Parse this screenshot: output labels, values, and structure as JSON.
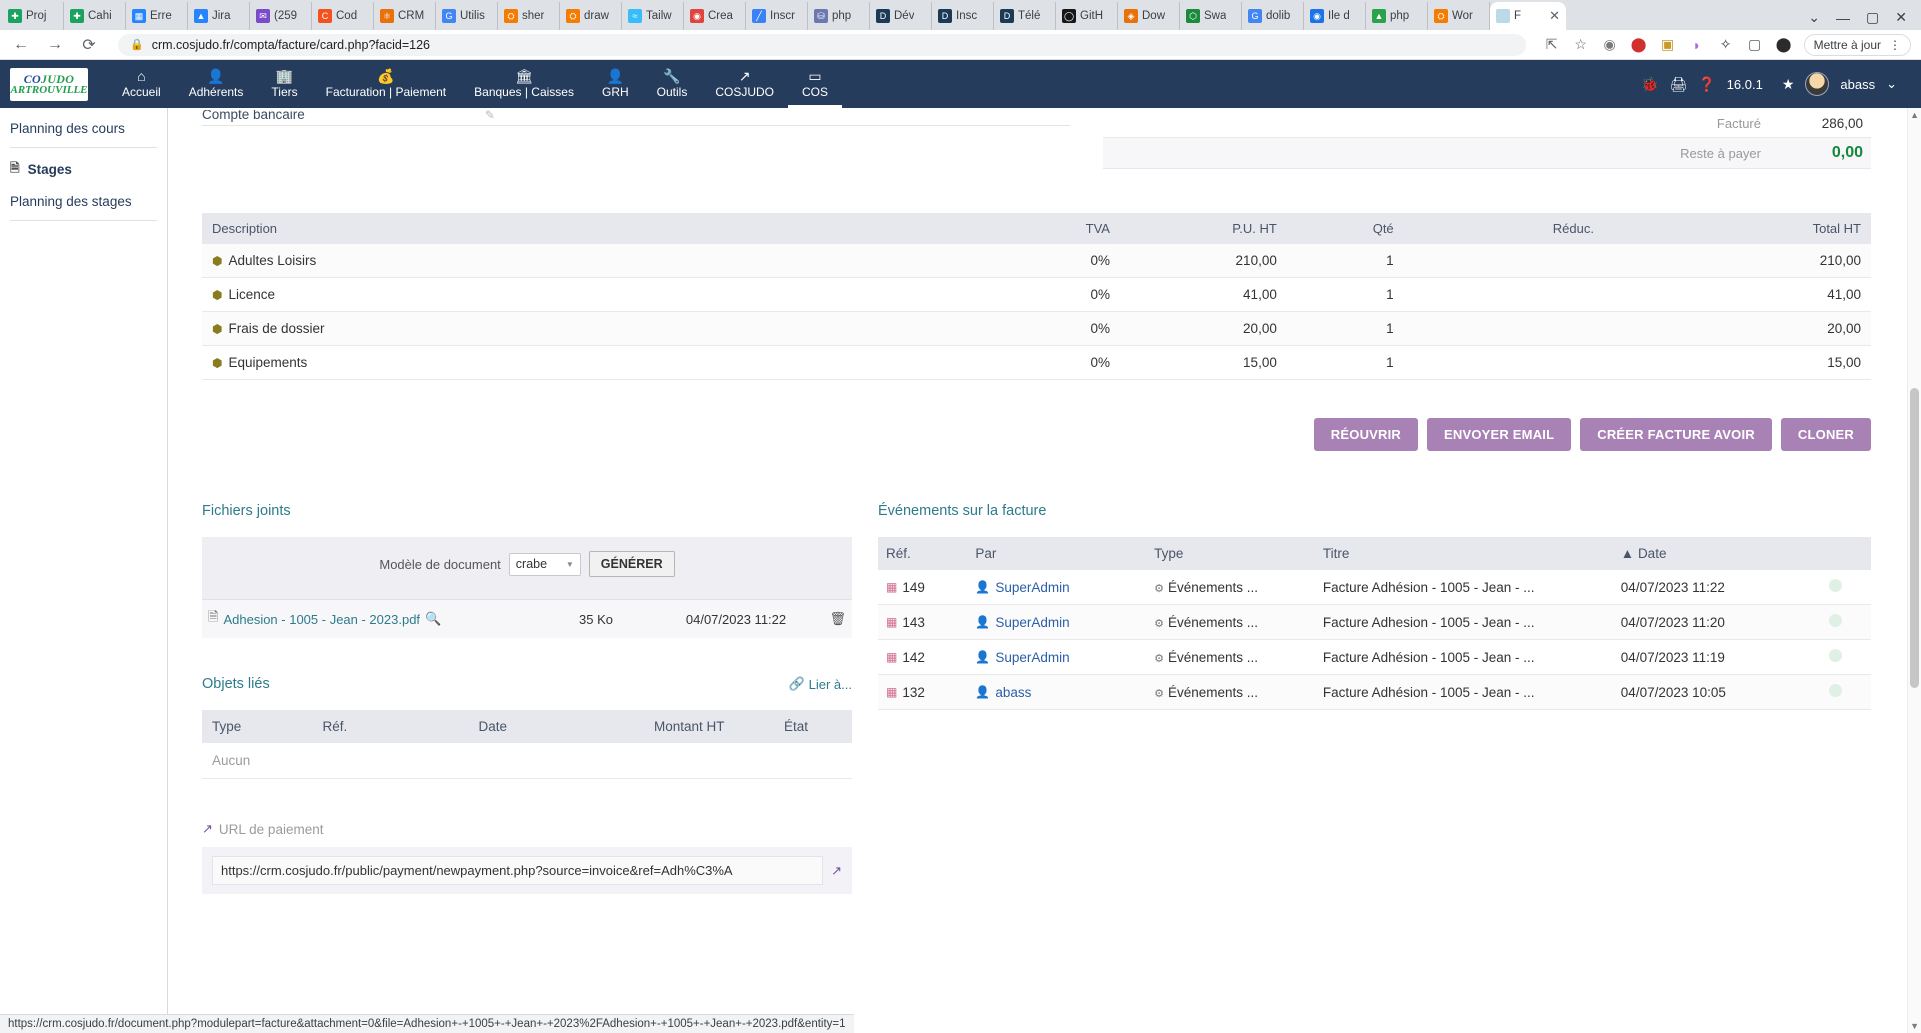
{
  "browser": {
    "tabs": [
      {
        "label": "Proj",
        "color": "#1aa260",
        "glyph": "✚"
      },
      {
        "label": "Cahi",
        "color": "#1aa260",
        "glyph": "✚"
      },
      {
        "label": "Erre",
        "color": "#2684ff",
        "glyph": "▦"
      },
      {
        "label": "Jira",
        "color": "#2684ff",
        "glyph": "▲"
      },
      {
        "label": "(259",
        "color": "#7b4cc9",
        "glyph": "✉"
      },
      {
        "label": "Cod",
        "color": "#f4511e",
        "glyph": "C"
      },
      {
        "label": "CRM",
        "color": "#e8710a",
        "glyph": "⚛"
      },
      {
        "label": "Utilis",
        "color": "#4285f4",
        "glyph": "G"
      },
      {
        "label": "sher",
        "color": "#f57c00",
        "glyph": "⛭"
      },
      {
        "label": "draw",
        "color": "#f57c00",
        "glyph": "⛭"
      },
      {
        "label": "Tailw",
        "color": "#38bdf8",
        "glyph": "≈"
      },
      {
        "label": "Crea",
        "color": "#e0443e",
        "glyph": "◉"
      },
      {
        "label": "Inscr",
        "color": "#3b82f6",
        "glyph": "╱"
      },
      {
        "label": "php",
        "color": "#6c78af",
        "glyph": "⛁"
      },
      {
        "label": "Dév",
        "color": "#1b3a57",
        "glyph": "D"
      },
      {
        "label": "Insc",
        "color": "#1b3a57",
        "glyph": "D"
      },
      {
        "label": "Télé",
        "color": "#1b3a57",
        "glyph": "D"
      },
      {
        "label": "GitH",
        "color": "#181717",
        "glyph": "◯"
      },
      {
        "label": "Dow",
        "color": "#e8710a",
        "glyph": "◈"
      },
      {
        "label": "Swa",
        "color": "#1b8a3a",
        "glyph": "⬡"
      },
      {
        "label": "dolib",
        "color": "#4285f4",
        "glyph": "G"
      },
      {
        "label": "Ile d",
        "color": "#1a73e8",
        "glyph": "◉"
      },
      {
        "label": "php",
        "color": "#2ba24c",
        "glyph": "▲"
      },
      {
        "label": "Wor",
        "color": "#f57c00",
        "glyph": "⛭"
      }
    ],
    "active_tab": {
      "label": "F",
      "close": "✕",
      "glyph": "▨"
    },
    "tabstrip_controls": {
      "chevron": "⌄",
      "minimize": "—",
      "maximize": "▢",
      "close": "✕"
    },
    "nav": {
      "back": "←",
      "forward": "→",
      "reload": "⟳"
    },
    "omnibox": {
      "lock": "🔒",
      "url": "crm.cosjudo.fr/compta/facture/card.php?facid=126"
    },
    "toolbar_icons": [
      "share-icon",
      "star-icon",
      "pocket-icon",
      "adblock-icon",
      "extension-badge-icon",
      "purple-ext-icon",
      "puzzle-icon",
      "sidebar-icon",
      "profile-icon"
    ],
    "update_button": "Mettre à jour",
    "menu_button": "⋮"
  },
  "app_header": {
    "logo_line1_a": "CO",
    "logo_line1_b": "JUDO",
    "logo_line2": "ARTROUVILLE",
    "menu": [
      {
        "label": "Accueil",
        "icon": "home-icon",
        "glyph": "⌂",
        "active": false
      },
      {
        "label": "Adhérents",
        "icon": "user-icon",
        "glyph": "👤",
        "active": false
      },
      {
        "label": "Tiers",
        "icon": "building-icon",
        "glyph": "🏢",
        "active": false
      },
      {
        "label": "Facturation | Paiement",
        "icon": "invoice-icon",
        "glyph": "💰",
        "active": false
      },
      {
        "label": "Banques | Caisses",
        "icon": "bank-icon",
        "glyph": "🏛",
        "active": false
      },
      {
        "label": "GRH",
        "icon": "hr-icon",
        "glyph": "👤",
        "active": false
      },
      {
        "label": "Outils",
        "icon": "wrench-icon",
        "glyph": "🔧",
        "active": false
      },
      {
        "label": "COSJUDO",
        "icon": "external-icon",
        "glyph": "↗",
        "active": false
      },
      {
        "label": "COS",
        "icon": "page-icon",
        "glyph": "▭",
        "active": true
      }
    ],
    "right": {
      "bug_icon": "🐞",
      "print_icon": "🖨",
      "help_icon": "❓",
      "version": "16.0.1",
      "star_icon": "★",
      "user_name": "abass",
      "caret": "⌄"
    }
  },
  "sidebar": {
    "items": [
      {
        "label": "Planning des cours",
        "bold": false,
        "icon": null
      },
      {
        "label": "Stages",
        "bold": true,
        "icon": "file-icon"
      },
      {
        "label": "Planning des stages",
        "bold": false,
        "icon": null
      }
    ]
  },
  "main": {
    "bank_account_label": "Compte bancaire",
    "totals": [
      {
        "label": "Facturé",
        "value": "286,00",
        "green": false
      },
      {
        "label": "Reste à payer",
        "value": "0,00",
        "green": true
      }
    ],
    "lines_table": {
      "headers": [
        "Description",
        "TVA",
        "P.U. HT",
        "Qté",
        "Réduc.",
        "Total HT"
      ],
      "rows": [
        {
          "description": "Adultes Loisirs",
          "tva": "0%",
          "pu_ht": "210,00",
          "qte": "1",
          "reduc": "",
          "total_ht": "210,00"
        },
        {
          "description": "Licence",
          "tva": "0%",
          "pu_ht": "41,00",
          "qte": "1",
          "reduc": "",
          "total_ht": "41,00"
        },
        {
          "description": "Frais de dossier",
          "tva": "0%",
          "pu_ht": "20,00",
          "qte": "1",
          "reduc": "",
          "total_ht": "20,00"
        },
        {
          "description": "Equipements",
          "tva": "0%",
          "pu_ht": "15,00",
          "qte": "1",
          "reduc": "",
          "total_ht": "15,00"
        }
      ]
    },
    "actions": [
      {
        "label": "RÉOUVRIR"
      },
      {
        "label": "ENVOYER EMAIL"
      },
      {
        "label": "CRÉER FACTURE AVOIR"
      },
      {
        "label": "CLONER"
      }
    ],
    "attachments": {
      "title": "Fichiers joints",
      "template_label": "Modèle de document",
      "template_value": "crabe",
      "generate_button": "GÉNÉRER",
      "files": [
        {
          "name": "Adhesion - 1005 - Jean - 2023.pdf",
          "size": "35 Ko",
          "date": "04/07/2023 11:22"
        }
      ]
    },
    "linked_objects": {
      "title": "Objets liés",
      "link_action": "Lier à...",
      "headers": [
        "Type",
        "Réf.",
        "Date",
        "Montant HT",
        "État"
      ],
      "empty_text": "Aucun"
    },
    "payment": {
      "label": "URL de paiement",
      "url": "https://crm.cosjudo.fr/public/payment/newpayment.php?source=invoice&ref=Adh%C3%A"
    },
    "events": {
      "title": "Événements sur la facture",
      "headers": [
        "Réf.",
        "Par",
        "Type",
        "Titre",
        "Date"
      ],
      "sort_indicator": "▲",
      "rows": [
        {
          "ref": "149",
          "par": "SuperAdmin",
          "type": "Événements ...",
          "titre": "Facture Adhésion - 1005 - Jean - ...",
          "date": "04/07/2023 11:22"
        },
        {
          "ref": "143",
          "par": "SuperAdmin",
          "type": "Événements ...",
          "titre": "Facture Adhesion - 1005 - Jean - ...",
          "date": "04/07/2023 11:20"
        },
        {
          "ref": "142",
          "par": "SuperAdmin",
          "type": "Événements ...",
          "titre": "Facture Adhésion - 1005 - Jean - ...",
          "date": "04/07/2023 11:19"
        },
        {
          "ref": "132",
          "par": "abass",
          "type": "Événements ...",
          "titre": "Facture Adhésion - 1005 - Jean - ...",
          "date": "04/07/2023 10:05"
        }
      ]
    }
  },
  "statusbar": {
    "text": "https://crm.cosjudo.fr/document.php?modulepart=facture&attachment=0&file=Adhesion+-+1005+-+Jean+-+2023%2FAdhesion+-+1005+-+Jean+-+2023.pdf&entity=1"
  }
}
